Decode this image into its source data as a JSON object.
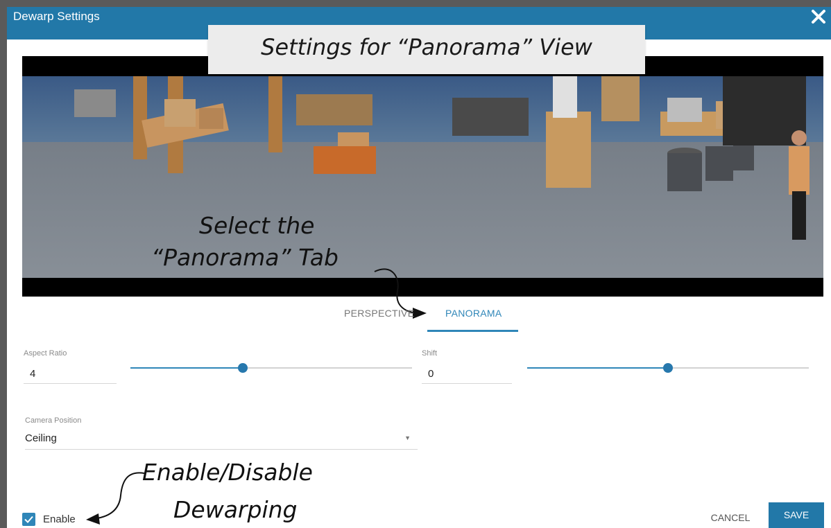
{
  "dialog": {
    "title": "Dewarp Settings"
  },
  "annotations": {
    "top_callout": "Settings for “Panorama” View",
    "tab_hint_line1": "Select the",
    "tab_hint_line2": "“Panorama” Tab",
    "enable_hint_line1": "Enable/Disable",
    "enable_hint_line2": "Dewarping"
  },
  "tabs": [
    {
      "label": "PERSPECTIVE",
      "active": false
    },
    {
      "label": "PANORAMA",
      "active": true
    }
  ],
  "aspect_ratio": {
    "label": "Aspect Ratio",
    "value": "4",
    "slider_fraction": 0.4
  },
  "shift": {
    "label": "Shift",
    "value": "0",
    "slider_fraction": 0.5
  },
  "camera_position": {
    "label": "Camera Position",
    "value": "Ceiling"
  },
  "footer": {
    "enable_label": "Enable",
    "enable_checked": true,
    "cancel_label": "CANCEL",
    "save_label": "SAVE"
  },
  "colors": {
    "title_bar": "#2278a8",
    "accent": "#2f86b8",
    "video_bg": "#000000"
  }
}
